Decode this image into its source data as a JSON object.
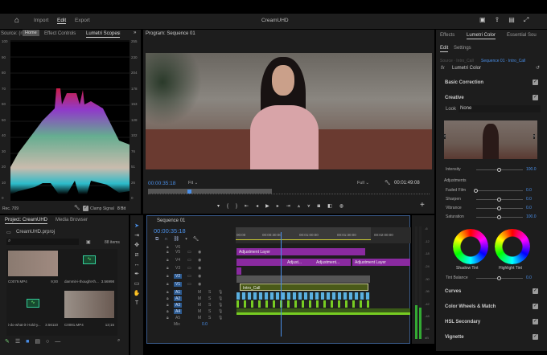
{
  "app": {
    "title": "CreamUHD",
    "nav": [
      "Import",
      "Edit",
      "Export"
    ],
    "active_nav": "Edit",
    "tooltip": "Home"
  },
  "left_panel": {
    "tabs": [
      "Source: (no clips)",
      "Effect Controls",
      "Lumetri Scopes"
    ],
    "left_ticks": [
      "100",
      "90",
      "80",
      "70",
      "60",
      "50",
      "40",
      "30",
      "20",
      "10",
      "0"
    ],
    "right_ticks": [
      "255",
      "230",
      "204",
      "178",
      "153",
      "128",
      "102",
      "76",
      "51",
      "26",
      "0"
    ],
    "footer": {
      "standard": "Rec. 709",
      "clamp_label": "Clamp Signal",
      "clamp_checked": true,
      "bit_depth": "8 Bit"
    }
  },
  "program": {
    "title": "Program: Sequence 01",
    "timecode": "00:00:35:18",
    "zoom": "Fit",
    "resolution": "Full",
    "duration": "00:01:49:08",
    "playhead_fraction": 0.32
  },
  "project": {
    "tabs": [
      "Project: CreamUHD",
      "Media Browser"
    ],
    "file": "CreamUHD.prproj",
    "search_placeholder": "",
    "count": "88 items",
    "items": [
      {
        "name": "C0079.MP4",
        "duration": "9;00",
        "type": "video"
      },
      {
        "name": "dammit-i-thought-th...",
        "duration": "3.56998",
        "type": "audio"
      },
      {
        "name": "i-do-what-it-i-told-y...",
        "duration": "3.56110",
        "type": "audio"
      },
      {
        "name": "C0081.MP4",
        "duration": "13;15",
        "type": "video"
      }
    ]
  },
  "timeline": {
    "title": "Sequence 01",
    "timecode": "00:00:35:18",
    "ruler": [
      "00:00",
      "00:00:30:00",
      "00:01:00:00",
      "00:01:30:00",
      "00:02:00:00"
    ],
    "video_tracks": [
      "V6",
      "V5",
      "V4",
      "V3",
      "V2",
      "V1"
    ],
    "audio_tracks": [
      "A1",
      "A2",
      "A3",
      "A4",
      "A5"
    ],
    "mix_label": "Mix",
    "mix_value": "0.0",
    "clips": {
      "v5": "Adjustment Layer",
      "v4": [
        "Adjust...",
        "Adjustment...",
        "Adjustment Layer"
      ],
      "v1": "Intro_Call"
    }
  },
  "meters": {
    "scale": [
      "-6",
      "-12",
      "-18",
      "-24",
      "-30",
      "-36",
      "-42",
      "-48",
      "-54"
    ],
    "unit": "dB"
  },
  "lumetri": {
    "tabs": [
      "Effects",
      "Lumetri Color",
      "Essential Sou"
    ],
    "subtabs": [
      "Edit",
      "Settings"
    ],
    "source": "Source · Intro_Call",
    "sequence": "Sequence 01 · Intro_Call",
    "effect": "Lumetri Color",
    "sections": {
      "basic": "Basic Correction",
      "creative": "Creative",
      "curves": "Curves",
      "wheels": "Color Wheels & Match",
      "hsl": "HSL Secondary",
      "vignette": "Vignette"
    },
    "look_label": "Look",
    "look_value": "None",
    "intensity": {
      "label": "Intensity",
      "value": "100.0",
      "fraction": 0.5
    },
    "adjustments_label": "Adjustments",
    "sliders": [
      {
        "label": "Faded Film",
        "value": "0.0",
        "fraction": 0.0
      },
      {
        "label": "Sharpen",
        "value": "0.0",
        "fraction": 0.5
      },
      {
        "label": "Vibrance",
        "value": "0.0",
        "fraction": 0.5
      },
      {
        "label": "Saturation",
        "value": "100.0",
        "fraction": 0.5
      }
    ],
    "shadow_tint": "Shadow Tint",
    "highlight_tint": "Highlight Tint",
    "tint_balance": {
      "label": "Tint Balance",
      "value": "0.0",
      "fraction": 0.5
    }
  }
}
